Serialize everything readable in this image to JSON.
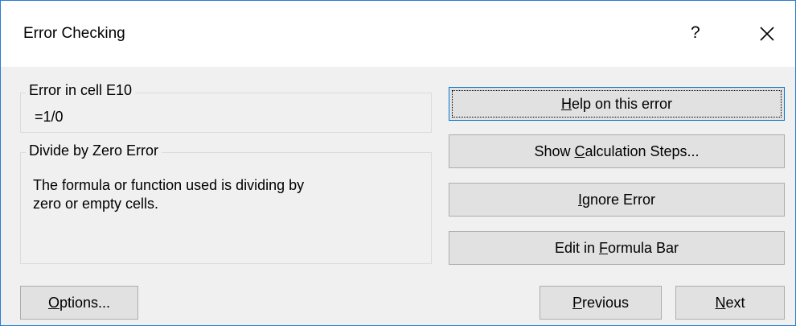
{
  "dialog": {
    "title": "Error Checking",
    "help_glyph": "?",
    "close_glyph": "×"
  },
  "error_group": {
    "label": "Error in cell E10",
    "formula": "=1/0"
  },
  "description_group": {
    "label": "Divide by Zero Error",
    "line1": "The formula or function used is dividing by",
    "line2": "zero or empty cells."
  },
  "buttons": {
    "help": {
      "pre": "",
      "key": "H",
      "post": "elp on this error"
    },
    "calc": {
      "pre": "Show ",
      "key": "C",
      "post": "alculation Steps..."
    },
    "ignore": {
      "pre": "",
      "key": "I",
      "post": "gnore Error"
    },
    "edit": {
      "pre": "Edit in ",
      "key": "F",
      "post": "ormula Bar"
    },
    "options": {
      "pre": "",
      "key": "O",
      "post": "ptions..."
    },
    "previous": {
      "pre": "",
      "key": "P",
      "post": "revious"
    },
    "next": {
      "pre": "",
      "key": "N",
      "post": "ext"
    }
  }
}
